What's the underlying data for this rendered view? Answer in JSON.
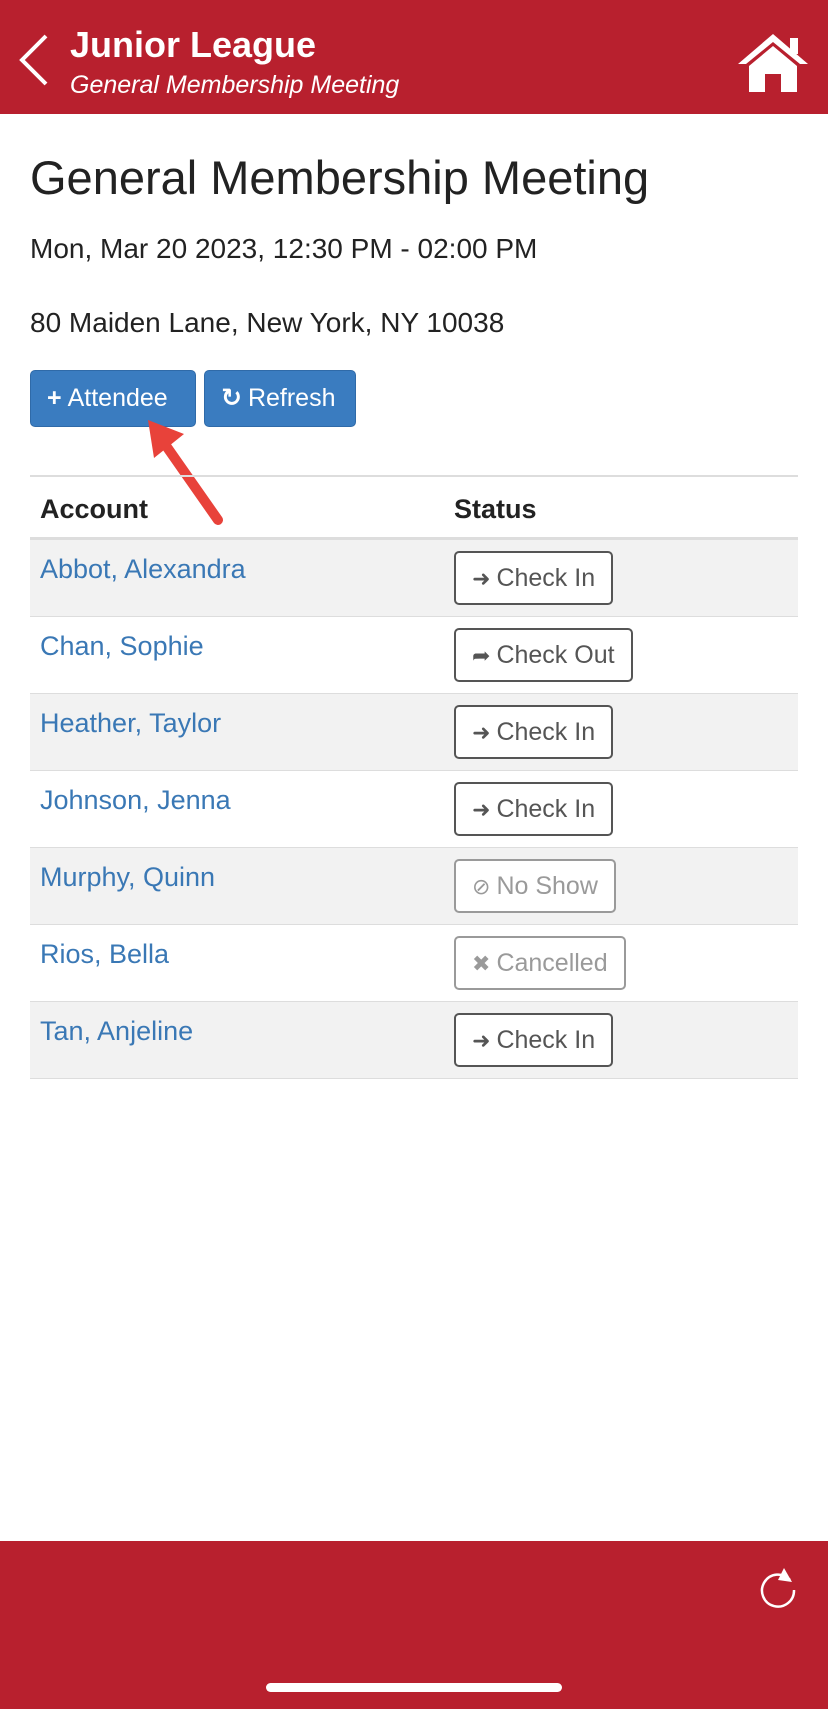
{
  "header": {
    "title": "Junior League",
    "subtitle": "General Membership Meeting",
    "back_icon": "chevron-left-icon",
    "home_icon": "home-icon",
    "color": "#b8202e"
  },
  "event": {
    "title": "General Membership Meeting",
    "datetime": "Mon, Mar 20 2023, 12:30 PM - 02:00 PM",
    "address": "80 Maiden Lane, New York, NY 10038"
  },
  "actions": {
    "attendee_icon": "+",
    "attendee_label": "Attendee",
    "refresh_icon": "↻",
    "refresh_label": "Refresh",
    "color": "#3a7cc0"
  },
  "table": {
    "headers": {
      "account": "Account",
      "status": "Status"
    },
    "rows": [
      {
        "name": "Abbot, Alexandra",
        "status": "Check In",
        "icon": "➜"
      },
      {
        "name": "Chan, Sophie",
        "status": "Check Out",
        "icon": "➦"
      },
      {
        "name": "Heather, Taylor",
        "status": "Check In",
        "icon": "➜"
      },
      {
        "name": "Johnson, Jenna",
        "status": "Check In",
        "icon": "➜"
      },
      {
        "name": "Murphy, Quinn",
        "status": "No Show",
        "icon": "⊘"
      },
      {
        "name": "Rios, Bella",
        "status": "Cancelled",
        "icon": "✖"
      },
      {
        "name": "Tan, Anjeline",
        "status": "Check In",
        "icon": "➜"
      }
    ]
  },
  "footer": {
    "reload_icon": "reload-icon"
  }
}
